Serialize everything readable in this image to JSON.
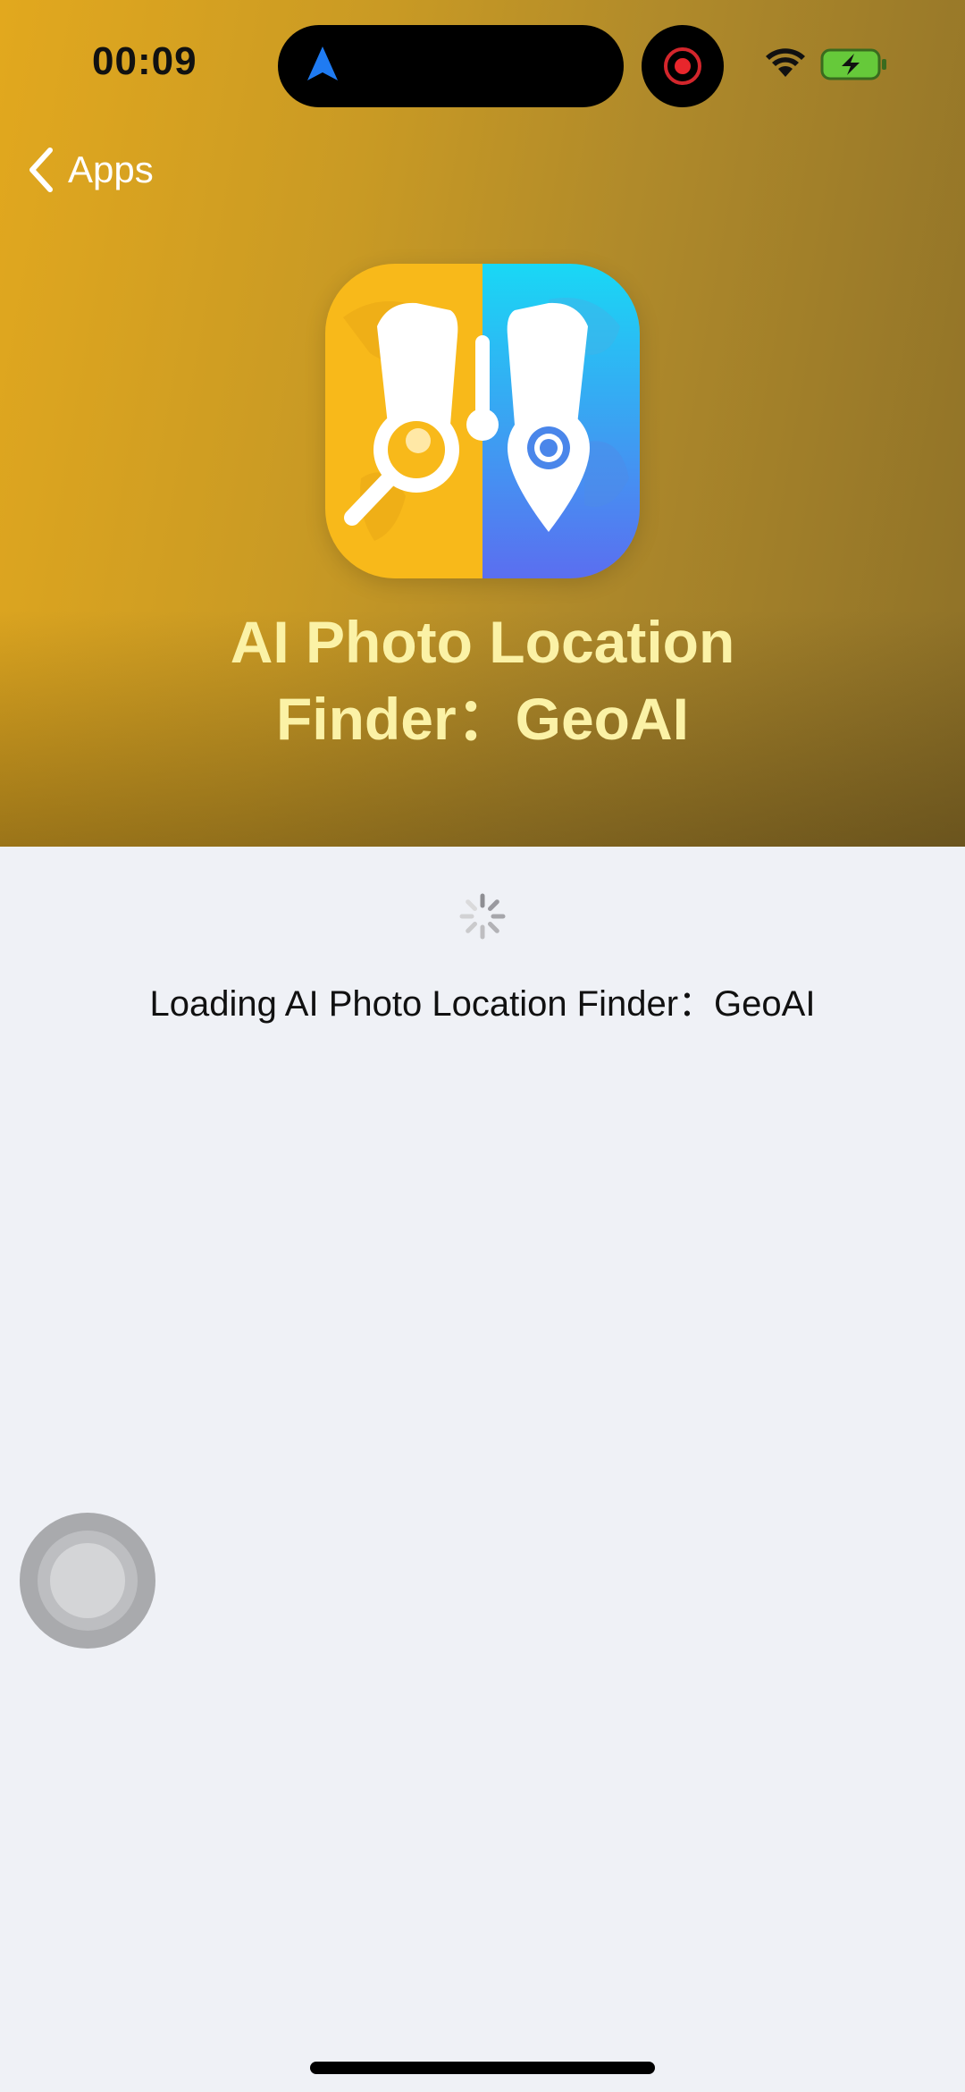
{
  "status_bar": {
    "time": "00:09",
    "icons": [
      "location-arrow-icon",
      "screen-record-icon",
      "wifi-icon",
      "battery-charging-icon"
    ]
  },
  "nav": {
    "back_label": "Apps"
  },
  "app": {
    "title_line1": "AI Photo Location",
    "title_line2": "Finder：GeoAI",
    "icon": "binoculars-app-icon"
  },
  "loading": {
    "text": "Loading AI Photo Location Finder：GeoAI"
  },
  "colors": {
    "hero_gold": "#d9a51f",
    "title_yellow": "#fbf2a6",
    "page_bg": "#eff1f6"
  }
}
